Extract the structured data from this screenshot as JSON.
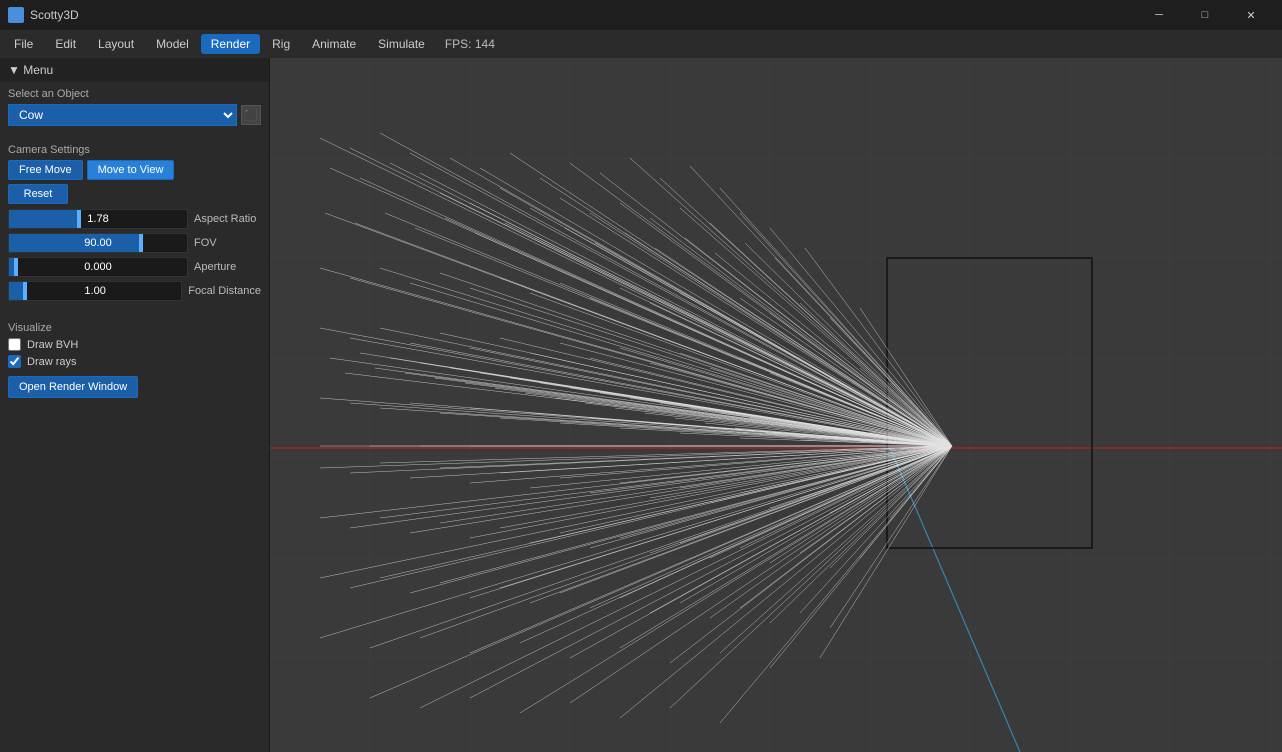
{
  "titlebar": {
    "title": "Scotty3D",
    "minimize_label": "─",
    "restore_label": "□",
    "close_label": "✕"
  },
  "menubar": {
    "items": [
      {
        "id": "file",
        "label": "File",
        "active": false
      },
      {
        "id": "edit",
        "label": "Edit",
        "active": false
      },
      {
        "id": "layout",
        "label": "Layout",
        "active": false
      },
      {
        "id": "model",
        "label": "Model",
        "active": false
      },
      {
        "id": "render",
        "label": "Render",
        "active": true
      },
      {
        "id": "rig",
        "label": "Rig",
        "active": false
      },
      {
        "id": "animate",
        "label": "Animate",
        "active": false
      },
      {
        "id": "simulate",
        "label": "Simulate",
        "active": false
      }
    ],
    "fps": "FPS: 144"
  },
  "sidebar": {
    "menu_label": "▼ Menu",
    "select_object_label": "Select an Object",
    "selected_object": "Cow",
    "camera_settings_label": "Camera Settings",
    "free_move_label": "Free Move",
    "move_to_view_label": "Move to View",
    "reset_label": "Reset",
    "sliders": [
      {
        "id": "aspect-ratio",
        "value": "1.78",
        "fill_pct": 40,
        "thumb_pct": 40,
        "label": "Aspect Ratio"
      },
      {
        "id": "fov",
        "value": "90.00",
        "fill_pct": 75,
        "thumb_pct": 75,
        "label": "FOV"
      },
      {
        "id": "aperture",
        "value": "0.000",
        "fill_pct": 5,
        "thumb_pct": 5,
        "label": "Aperture"
      },
      {
        "id": "focal-distance",
        "value": "1.00",
        "fill_pct": 10,
        "thumb_pct": 10,
        "label": "Focal Distance"
      }
    ],
    "visualize_label": "Visualize",
    "draw_bvh_label": "Draw BVH",
    "draw_bvh_checked": false,
    "draw_rays_label": "Draw rays",
    "draw_rays_checked": true,
    "open_render_label": "Open Render Window"
  },
  "colors": {
    "accent": "#1a5fa8",
    "active_tab": "#1a6bbf",
    "sidebar_bg": "#2a2a2a",
    "viewport_bg": "#3a3a3a",
    "titlebar_bg": "#1e1e1e"
  }
}
